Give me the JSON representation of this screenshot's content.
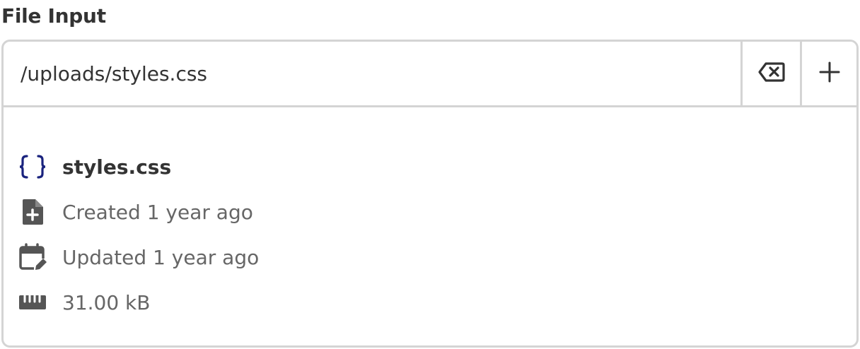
{
  "field": {
    "label": "File Input",
    "value": "/uploads/styles.css",
    "clear_icon": "backspace-clear-icon",
    "add_icon": "plus-icon"
  },
  "file": {
    "name": "styles.css",
    "type_icon": "curly-braces-icon",
    "created": "Created 1 year ago",
    "created_icon": "file-add-icon",
    "updated": "Updated 1 year ago",
    "updated_icon": "calendar-edit-icon",
    "size": "31.00 kB",
    "size_icon": "ruler-icon"
  },
  "colors": {
    "text": "#333333",
    "muted": "#666666",
    "border": "#d4d4d4",
    "icon": "#555555",
    "accent": "#1a237e"
  }
}
